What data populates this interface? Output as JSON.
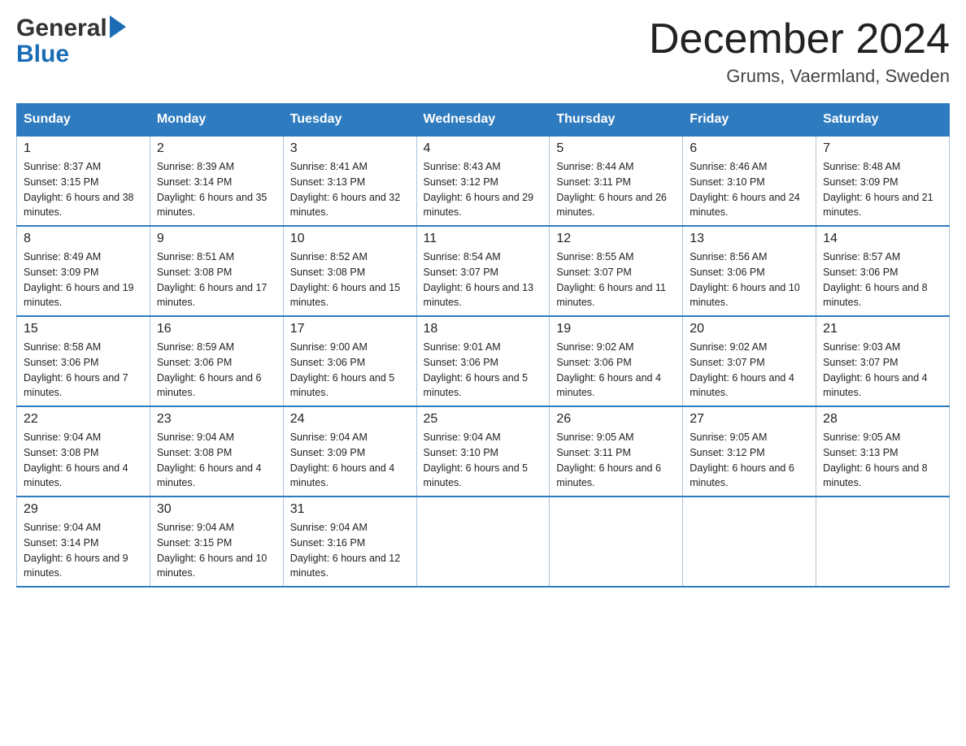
{
  "header": {
    "logo_general": "General",
    "logo_blue": "Blue",
    "month_title": "December 2024",
    "location": "Grums, Vaermland, Sweden"
  },
  "days_of_week": [
    "Sunday",
    "Monday",
    "Tuesday",
    "Wednesday",
    "Thursday",
    "Friday",
    "Saturday"
  ],
  "weeks": [
    [
      {
        "day": "1",
        "sunrise": "Sunrise: 8:37 AM",
        "sunset": "Sunset: 3:15 PM",
        "daylight": "Daylight: 6 hours and 38 minutes."
      },
      {
        "day": "2",
        "sunrise": "Sunrise: 8:39 AM",
        "sunset": "Sunset: 3:14 PM",
        "daylight": "Daylight: 6 hours and 35 minutes."
      },
      {
        "day": "3",
        "sunrise": "Sunrise: 8:41 AM",
        "sunset": "Sunset: 3:13 PM",
        "daylight": "Daylight: 6 hours and 32 minutes."
      },
      {
        "day": "4",
        "sunrise": "Sunrise: 8:43 AM",
        "sunset": "Sunset: 3:12 PM",
        "daylight": "Daylight: 6 hours and 29 minutes."
      },
      {
        "day": "5",
        "sunrise": "Sunrise: 8:44 AM",
        "sunset": "Sunset: 3:11 PM",
        "daylight": "Daylight: 6 hours and 26 minutes."
      },
      {
        "day": "6",
        "sunrise": "Sunrise: 8:46 AM",
        "sunset": "Sunset: 3:10 PM",
        "daylight": "Daylight: 6 hours and 24 minutes."
      },
      {
        "day": "7",
        "sunrise": "Sunrise: 8:48 AM",
        "sunset": "Sunset: 3:09 PM",
        "daylight": "Daylight: 6 hours and 21 minutes."
      }
    ],
    [
      {
        "day": "8",
        "sunrise": "Sunrise: 8:49 AM",
        "sunset": "Sunset: 3:09 PM",
        "daylight": "Daylight: 6 hours and 19 minutes."
      },
      {
        "day": "9",
        "sunrise": "Sunrise: 8:51 AM",
        "sunset": "Sunset: 3:08 PM",
        "daylight": "Daylight: 6 hours and 17 minutes."
      },
      {
        "day": "10",
        "sunrise": "Sunrise: 8:52 AM",
        "sunset": "Sunset: 3:08 PM",
        "daylight": "Daylight: 6 hours and 15 minutes."
      },
      {
        "day": "11",
        "sunrise": "Sunrise: 8:54 AM",
        "sunset": "Sunset: 3:07 PM",
        "daylight": "Daylight: 6 hours and 13 minutes."
      },
      {
        "day": "12",
        "sunrise": "Sunrise: 8:55 AM",
        "sunset": "Sunset: 3:07 PM",
        "daylight": "Daylight: 6 hours and 11 minutes."
      },
      {
        "day": "13",
        "sunrise": "Sunrise: 8:56 AM",
        "sunset": "Sunset: 3:06 PM",
        "daylight": "Daylight: 6 hours and 10 minutes."
      },
      {
        "day": "14",
        "sunrise": "Sunrise: 8:57 AM",
        "sunset": "Sunset: 3:06 PM",
        "daylight": "Daylight: 6 hours and 8 minutes."
      }
    ],
    [
      {
        "day": "15",
        "sunrise": "Sunrise: 8:58 AM",
        "sunset": "Sunset: 3:06 PM",
        "daylight": "Daylight: 6 hours and 7 minutes."
      },
      {
        "day": "16",
        "sunrise": "Sunrise: 8:59 AM",
        "sunset": "Sunset: 3:06 PM",
        "daylight": "Daylight: 6 hours and 6 minutes."
      },
      {
        "day": "17",
        "sunrise": "Sunrise: 9:00 AM",
        "sunset": "Sunset: 3:06 PM",
        "daylight": "Daylight: 6 hours and 5 minutes."
      },
      {
        "day": "18",
        "sunrise": "Sunrise: 9:01 AM",
        "sunset": "Sunset: 3:06 PM",
        "daylight": "Daylight: 6 hours and 5 minutes."
      },
      {
        "day": "19",
        "sunrise": "Sunrise: 9:02 AM",
        "sunset": "Sunset: 3:06 PM",
        "daylight": "Daylight: 6 hours and 4 minutes."
      },
      {
        "day": "20",
        "sunrise": "Sunrise: 9:02 AM",
        "sunset": "Sunset: 3:07 PM",
        "daylight": "Daylight: 6 hours and 4 minutes."
      },
      {
        "day": "21",
        "sunrise": "Sunrise: 9:03 AM",
        "sunset": "Sunset: 3:07 PM",
        "daylight": "Daylight: 6 hours and 4 minutes."
      }
    ],
    [
      {
        "day": "22",
        "sunrise": "Sunrise: 9:04 AM",
        "sunset": "Sunset: 3:08 PM",
        "daylight": "Daylight: 6 hours and 4 minutes."
      },
      {
        "day": "23",
        "sunrise": "Sunrise: 9:04 AM",
        "sunset": "Sunset: 3:08 PM",
        "daylight": "Daylight: 6 hours and 4 minutes."
      },
      {
        "day": "24",
        "sunrise": "Sunrise: 9:04 AM",
        "sunset": "Sunset: 3:09 PM",
        "daylight": "Daylight: 6 hours and 4 minutes."
      },
      {
        "day": "25",
        "sunrise": "Sunrise: 9:04 AM",
        "sunset": "Sunset: 3:10 PM",
        "daylight": "Daylight: 6 hours and 5 minutes."
      },
      {
        "day": "26",
        "sunrise": "Sunrise: 9:05 AM",
        "sunset": "Sunset: 3:11 PM",
        "daylight": "Daylight: 6 hours and 6 minutes."
      },
      {
        "day": "27",
        "sunrise": "Sunrise: 9:05 AM",
        "sunset": "Sunset: 3:12 PM",
        "daylight": "Daylight: 6 hours and 6 minutes."
      },
      {
        "day": "28",
        "sunrise": "Sunrise: 9:05 AM",
        "sunset": "Sunset: 3:13 PM",
        "daylight": "Daylight: 6 hours and 8 minutes."
      }
    ],
    [
      {
        "day": "29",
        "sunrise": "Sunrise: 9:04 AM",
        "sunset": "Sunset: 3:14 PM",
        "daylight": "Daylight: 6 hours and 9 minutes."
      },
      {
        "day": "30",
        "sunrise": "Sunrise: 9:04 AM",
        "sunset": "Sunset: 3:15 PM",
        "daylight": "Daylight: 6 hours and 10 minutes."
      },
      {
        "day": "31",
        "sunrise": "Sunrise: 9:04 AM",
        "sunset": "Sunset: 3:16 PM",
        "daylight": "Daylight: 6 hours and 12 minutes."
      },
      null,
      null,
      null,
      null
    ]
  ]
}
